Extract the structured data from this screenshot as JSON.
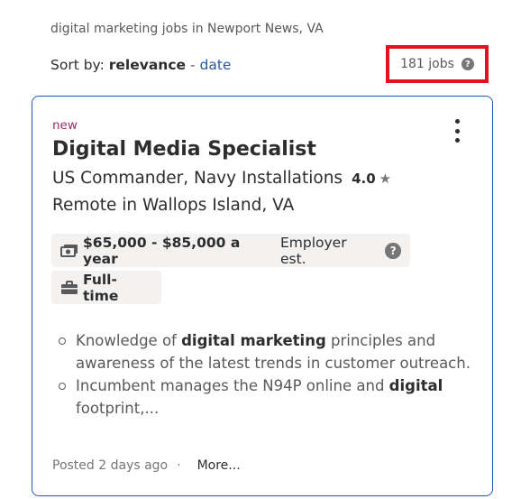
{
  "search_context": "digital marketing jobs in Newport News, VA",
  "sort": {
    "prefix": "Sort by:",
    "active": "relevance",
    "separator": "-",
    "alternate": "date"
  },
  "job_count": "181 jobs",
  "job_count_help_glyph": "?",
  "card": {
    "new_label": "new",
    "title": "Digital Media Specialist",
    "company": "US Commander, Navy Installations",
    "rating": "4.0",
    "rating_star": "★",
    "location": "Remote in Wallops Island, VA",
    "salary": "$65,000 - $85,000 a year",
    "salary_note": "Employer est.",
    "salary_help_glyph": "?",
    "job_type": "Full-time",
    "snippet": [
      {
        "before": "Knowledge of ",
        "bold": "digital marketing",
        "after": " principles and awareness of the latest trends in customer outreach."
      },
      {
        "before": "Incumbent manages the N94P online and ",
        "bold": "digital",
        "after": " footprint,..."
      }
    ],
    "posted": "Posted 2 days ago",
    "dot": "·",
    "more_label": "More..."
  },
  "colors": {
    "highlight_box": "#e3111b",
    "card_border": "#2557a7",
    "new_tag": "#9d2b6b",
    "link": "#2557a7"
  },
  "icons": {
    "salary": "money-bill-icon",
    "job_type": "briefcase-icon",
    "menu": "kebab-menu-icon",
    "rating": "star-icon"
  }
}
